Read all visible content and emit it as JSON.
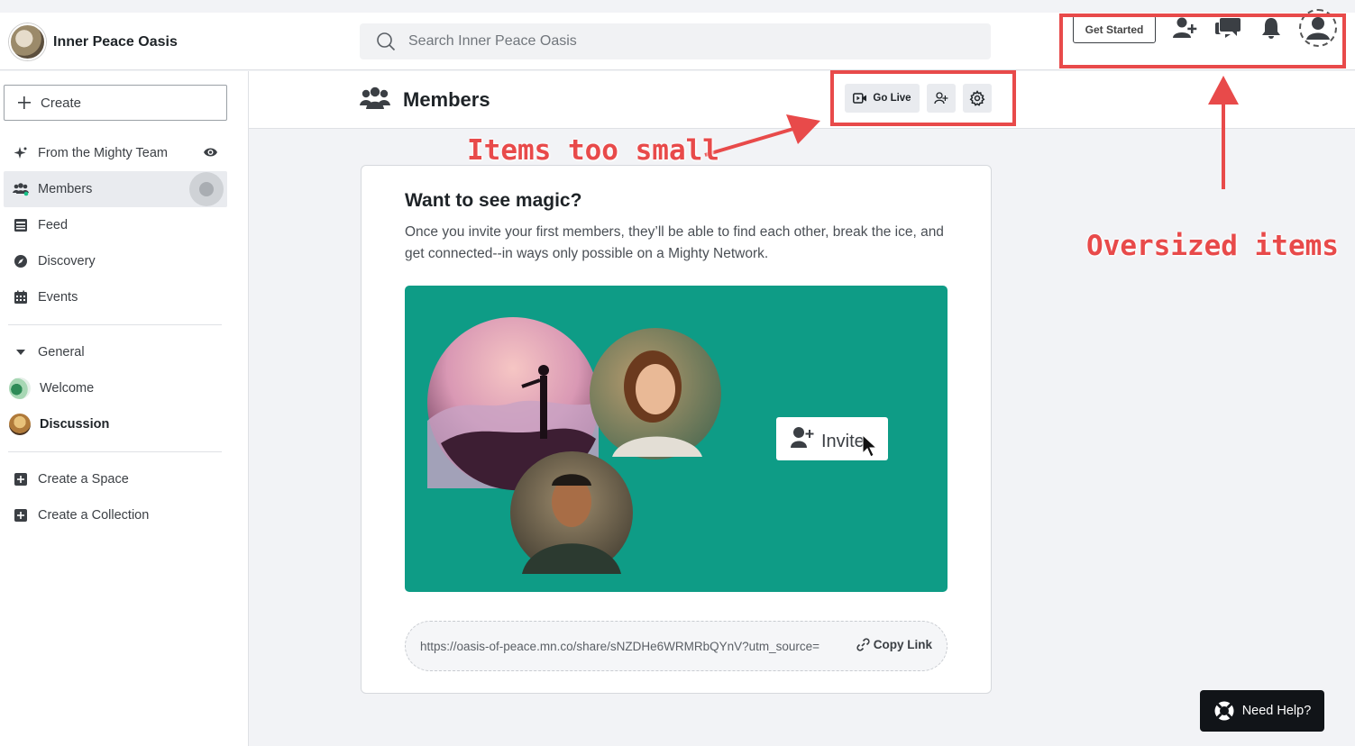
{
  "brand": {
    "name": "Inner Peace Oasis"
  },
  "search": {
    "placeholder": "Search Inner Peace Oasis"
  },
  "top_actions": {
    "get_started": "Get Started"
  },
  "sidebar": {
    "create_label": "Create",
    "items": [
      {
        "label": "From the Mighty Team",
        "icon": "sparkle-icon"
      },
      {
        "label": "Members",
        "icon": "members-icon"
      },
      {
        "label": "Feed",
        "icon": "feed-icon"
      },
      {
        "label": "Discovery",
        "icon": "compass-icon"
      },
      {
        "label": "Events",
        "icon": "calendar-icon"
      }
    ],
    "section_label": "General",
    "spaces": [
      {
        "label": "Welcome"
      },
      {
        "label": "Discussion"
      }
    ],
    "create_space": "Create a Space",
    "create_collection": "Create a Collection"
  },
  "header": {
    "title": "Members",
    "go_live": "Go Live"
  },
  "card": {
    "title": "Want to see magic?",
    "description": "Once you invite your first members, they’ll be able to find each other, break the ice, and get connected--in ways only possible on a Mighty Network.",
    "invite_label": "Invite",
    "share_link": "https://oasis-of-peace.mn.co/share/sNZDHe6WRMRbQYnV?utm_source=",
    "copy_link": "Copy Link"
  },
  "help": {
    "label": "Need Help?"
  },
  "annotations": {
    "small": "Items too small",
    "oversized": "Oversized items",
    "color": "#e84a4a"
  }
}
